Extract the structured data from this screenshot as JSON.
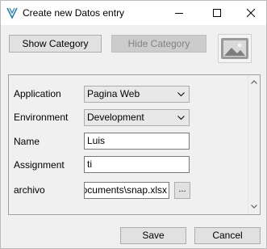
{
  "window": {
    "title": "Create new Datos entry",
    "icons": {
      "app": "app-logo-icon",
      "minimize": "minimize-icon",
      "maximize": "maximize-icon",
      "close": "close-icon"
    }
  },
  "toolbar": {
    "show_category_label": "Show Category",
    "hide_category_label": "Hide Category",
    "image_icon": "picture-icon"
  },
  "form": {
    "fields": [
      {
        "label": "Application",
        "type": "dropdown",
        "value": "Pagina Web"
      },
      {
        "label": "Environment",
        "type": "dropdown",
        "value": "Development"
      },
      {
        "label": "Name",
        "type": "text",
        "value": "Luis"
      },
      {
        "label": "Assignment",
        "type": "text",
        "value": "ti"
      },
      {
        "label": "archivo",
        "type": "file",
        "value": "ocuments\\snap.xlsx",
        "browse_label": "..."
      }
    ]
  },
  "footer": {
    "save_label": "Save",
    "cancel_label": "Cancel"
  }
}
